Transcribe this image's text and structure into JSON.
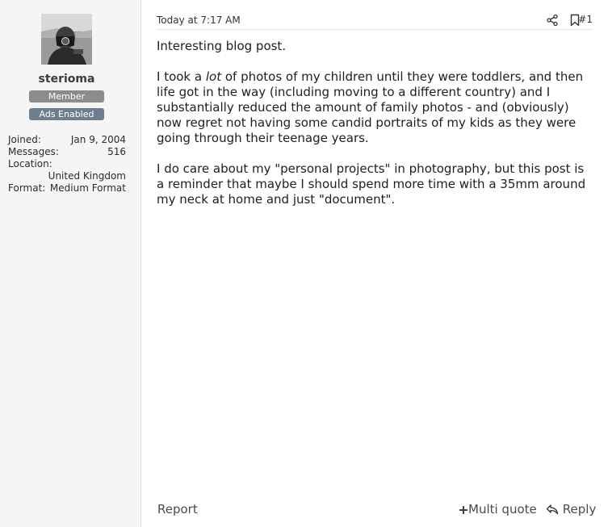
{
  "user": {
    "name": "sterioma",
    "badges": [
      "Member",
      "Ads Enabled"
    ],
    "stats": {
      "joined_label": "Joined:",
      "joined_value": "Jan 9, 2004",
      "messages_label": "Messages:",
      "messages_value": "516",
      "location_label": "Location:",
      "location_value": "United Kingdom",
      "format_label": "Format:",
      "format_value": "Medium Format"
    }
  },
  "post": {
    "date": "Today at 7:17 AM",
    "number": "#1",
    "paragraph1": "Interesting blog post.",
    "paragraph2_before": "I took a ",
    "paragraph2_em": "lot",
    "paragraph2_after": " of photos of my children until they were toddlers, and then life got in the way (including moving to a different country) and I substantially reduced the amount of family photos - and (obviously) now regret not having some candid portraits of my kids as they were going through their teenage years.",
    "paragraph3": "I do care about my \"personal projects\" in photography, but this post is a reminder that maybe I should spend more time with a 35mm around my neck at home and just \"document\"."
  },
  "actions": {
    "report": "Report",
    "multi_quote": "Multi quote",
    "reply": "Reply"
  },
  "icons": {
    "share": "share-icon",
    "bookmark": "bookmark-icon",
    "plus": "plus-icon",
    "reply": "reply-arrow-icon"
  },
  "colors": {
    "badge_member": "#8c8c8c",
    "badge_ads": "#6d7f8e",
    "sidebar_bg": "#f5f5f5"
  }
}
